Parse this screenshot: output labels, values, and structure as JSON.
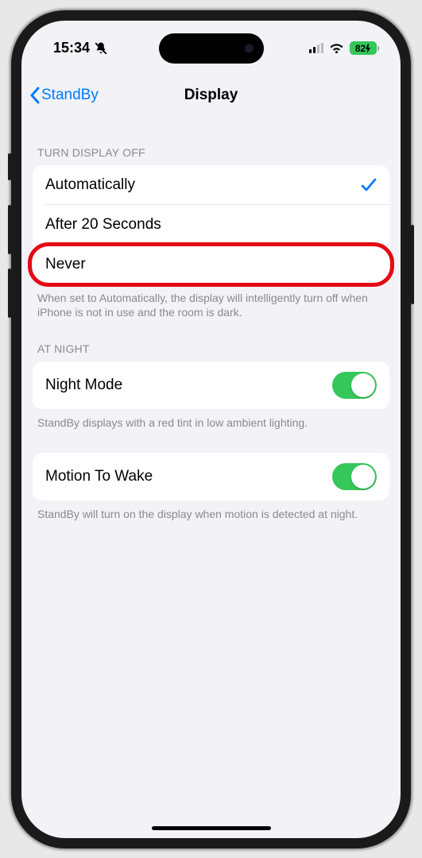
{
  "status": {
    "time": "15:34",
    "battery": "82"
  },
  "nav": {
    "back": "StandBy",
    "title": "Display"
  },
  "section1": {
    "header": "Turn Display Off",
    "options": {
      "auto": "Automatically",
      "after20": "After 20 Seconds",
      "never": "Never"
    },
    "footer": "When set to Automatically, the display will intelligently turn off when iPhone is not in use and the room is dark."
  },
  "section2": {
    "header": "At Night",
    "night_mode": "Night Mode",
    "footer": "StandBy displays with a red tint in low ambient lighting."
  },
  "section3": {
    "motion": "Motion To Wake",
    "footer": "StandBy will turn on the display when motion is detected at night."
  }
}
